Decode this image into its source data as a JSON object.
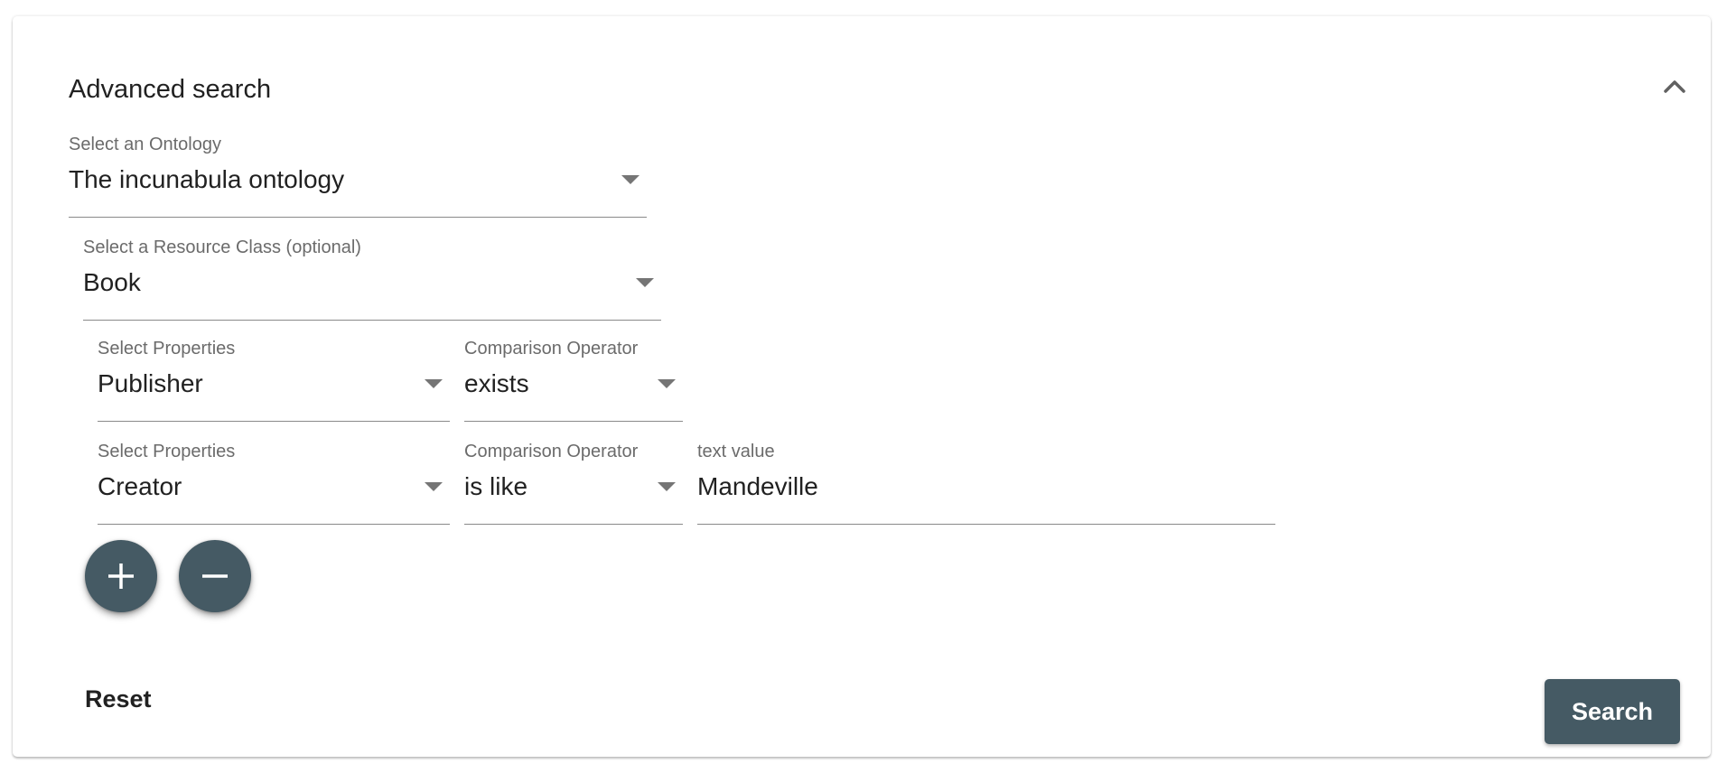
{
  "panel": {
    "title": "Advanced search",
    "collapse_icon": "chevron-up-icon"
  },
  "ontology": {
    "label": "Select an Ontology",
    "value": "The incunabula ontology"
  },
  "resource_class": {
    "label": "Select a Resource Class (optional)",
    "value": "Book"
  },
  "properties": [
    {
      "property_label": "Select Properties",
      "property_value": "Publisher",
      "operator_label": "Comparison Operator",
      "operator_value": "exists"
    },
    {
      "property_label": "Select Properties",
      "property_value": "Creator",
      "operator_label": "Comparison Operator",
      "operator_value": "is like",
      "text_label": "text value",
      "text_value": "Mandeville"
    }
  ],
  "actions": {
    "add_icon": "plus-icon",
    "remove_icon": "minus-icon",
    "reset_label": "Reset",
    "search_label": "Search"
  },
  "colors": {
    "primary": "#455a64",
    "text": "#212121",
    "label": "#6b6b6b"
  }
}
